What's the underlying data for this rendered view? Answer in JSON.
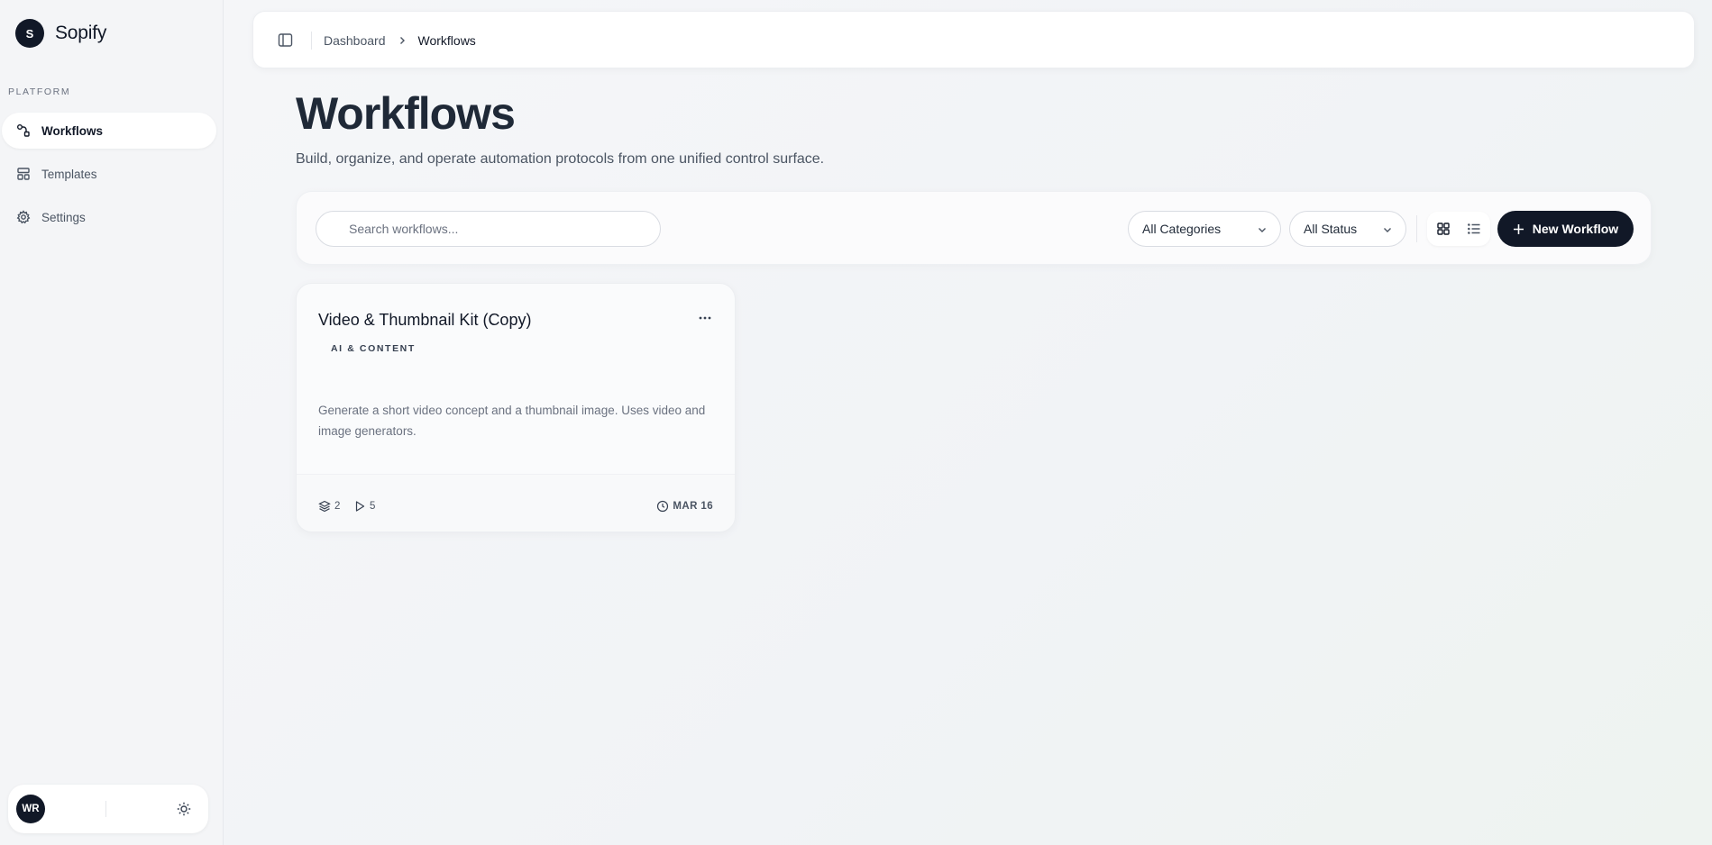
{
  "brand": {
    "logo_letter": "S",
    "name": "Sopify"
  },
  "sidebar": {
    "section_label": "PLATFORM",
    "items": [
      {
        "label": "Workflows",
        "icon": "workflow-icon",
        "active": true
      },
      {
        "label": "Templates",
        "icon": "template-icon",
        "active": false
      },
      {
        "label": "Settings",
        "icon": "gear-icon",
        "active": false
      }
    ]
  },
  "user": {
    "initials": "WR",
    "theme_icon": "sun-icon"
  },
  "topbar": {
    "breadcrumb": {
      "parent": "Dashboard",
      "current": "Workflows"
    }
  },
  "header": {
    "title": "Workflows",
    "subtitle": "Build, organize, and operate automation protocols from one unified control surface."
  },
  "toolbar": {
    "search_placeholder": "Search workflows...",
    "category_select": "All Categories",
    "status_select": "All Status",
    "new_button_label": "New Workflow"
  },
  "workflows": [
    {
      "title": "Video & Thumbnail Kit (Copy)",
      "category": "AI & CONTENT",
      "description": "Generate a short video concept and a thumbnail image. Uses video and image generators.",
      "steps": "2",
      "runs": "5",
      "date": "MAR 16"
    }
  ],
  "colors": {
    "primary": "#111827",
    "background": "#f4f5f7",
    "muted_text": "#6b7280"
  }
}
